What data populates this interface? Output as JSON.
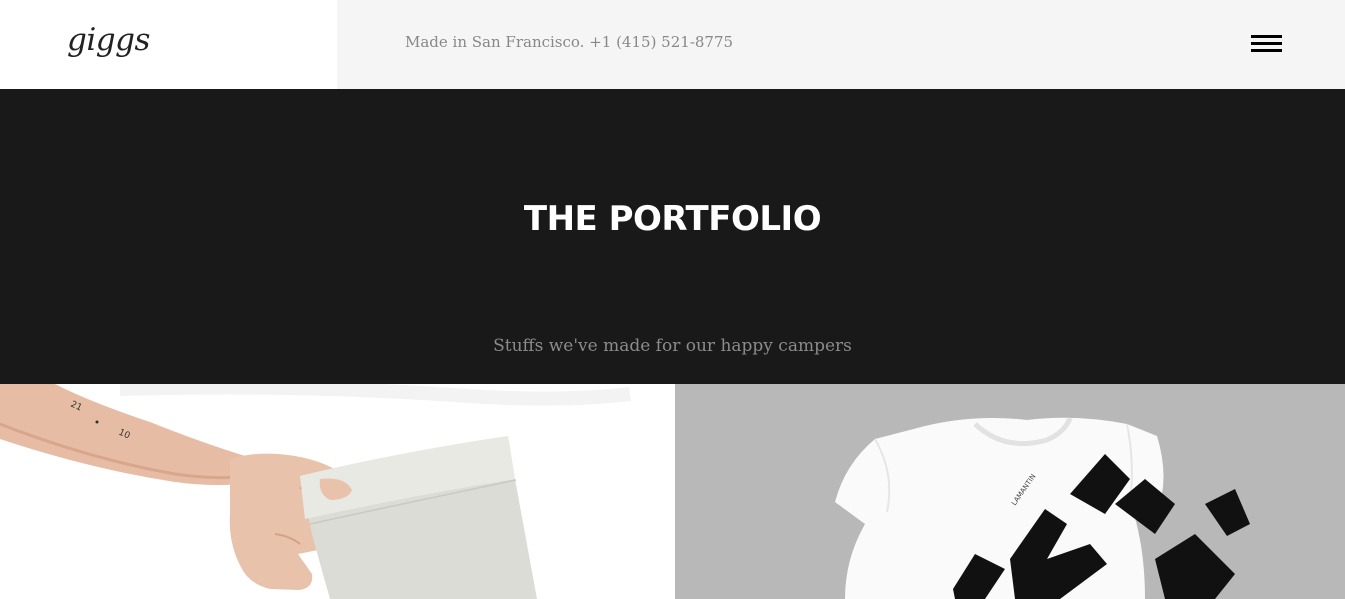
{
  "header": {
    "logo": "giggs",
    "contact": "Made in San Francisco. +1 (415) 521-8775",
    "menu_icon": "hamburger-menu-icon"
  },
  "hero": {
    "title": "THE PORTFOLIO",
    "subtitle": "Stuffs we've made for our happy campers"
  },
  "portfolio": {
    "items": [
      {
        "label": "",
        "image": "hand-holding-paper-bag-photo"
      },
      {
        "label": "LAMANTIN",
        "image": "white-tshirt-photo"
      }
    ]
  },
  "colors": {
    "header_bg": "#f5f5f5",
    "hero_bg": "#191919",
    "title": "#ffffff",
    "subtitle": "#8b8b8b"
  }
}
